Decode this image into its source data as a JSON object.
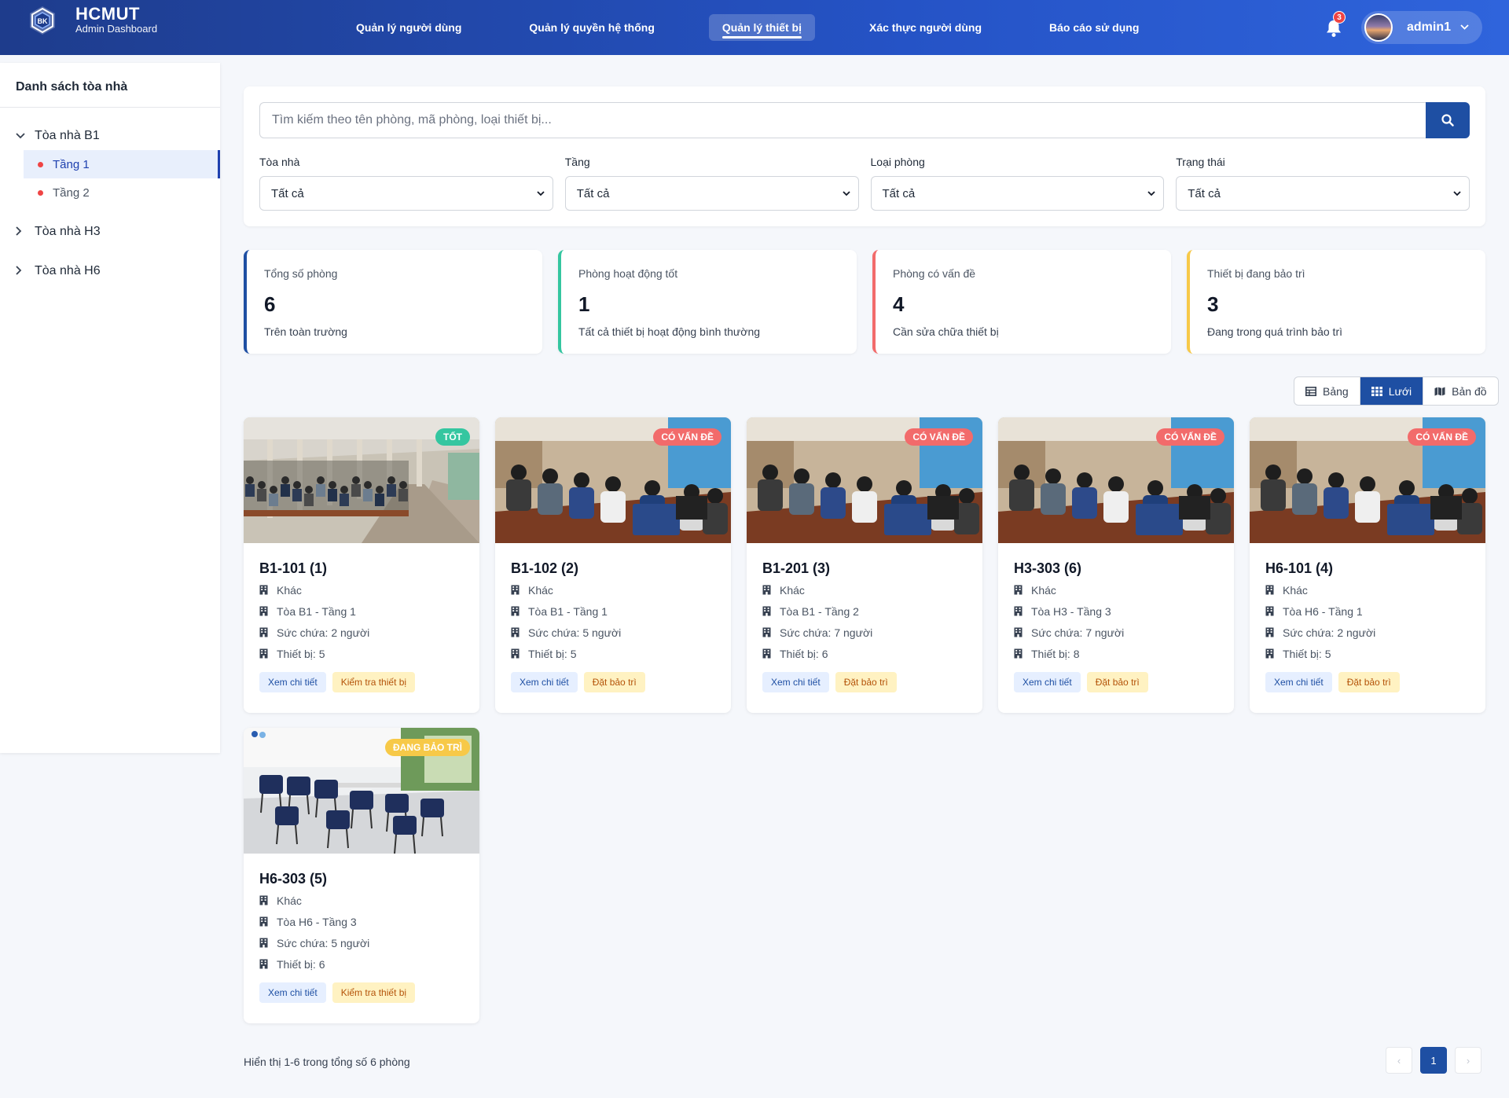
{
  "brand": {
    "title": "HCMUT",
    "subtitle": "Admin Dashboard",
    "logo_text": "BK"
  },
  "nav": [
    {
      "label": "Quản lý người dùng",
      "active": false
    },
    {
      "label": "Quản lý quyền hệ thống",
      "active": false
    },
    {
      "label": "Quản lý thiết bị",
      "active": true
    },
    {
      "label": "Xác thực người dùng",
      "active": false
    },
    {
      "label": "Báo cáo sử dụng",
      "active": false
    }
  ],
  "notifications": {
    "count": "3"
  },
  "user": {
    "name": "admin1"
  },
  "sidebar": {
    "title": "Danh sách tòa nhà",
    "buildings": [
      {
        "label": "Tòa nhà B1",
        "expanded": true,
        "floors": [
          {
            "label": "Tầng 1",
            "active": true
          },
          {
            "label": "Tầng 2",
            "active": false
          }
        ]
      },
      {
        "label": "Tòa nhà H3",
        "expanded": false,
        "floors": []
      },
      {
        "label": "Tòa nhà H6",
        "expanded": false,
        "floors": []
      }
    ]
  },
  "search": {
    "placeholder": "Tìm kiếm theo tên phòng, mã phòng, loại thiết bị..."
  },
  "filters": [
    {
      "label": "Tòa nhà",
      "value": "Tất cả"
    },
    {
      "label": "Tầng",
      "value": "Tất cả"
    },
    {
      "label": "Loại phòng",
      "value": "Tất cả"
    },
    {
      "label": "Trạng thái",
      "value": "Tất cả"
    }
  ],
  "stats": [
    {
      "label": "Tổng số phòng",
      "value": "6",
      "desc": "Trên toàn trường",
      "color": "#1e4fa3"
    },
    {
      "label": "Phòng hoạt động tốt",
      "value": "1",
      "desc": "Tất cả thiết bị hoạt động bình thường",
      "color": "#34c6a0"
    },
    {
      "label": "Phòng có vấn đề",
      "value": "4",
      "desc": "Cần sửa chữa thiết bị",
      "color": "#f26b6b"
    },
    {
      "label": "Thiết bị đang bảo trì",
      "value": "3",
      "desc": "Đang trong quá trình bảo trì",
      "color": "#f7c948"
    }
  ],
  "view_modes": [
    {
      "label": "Bảng",
      "active": false,
      "icon": "table-icon"
    },
    {
      "label": "Lưới",
      "active": true,
      "icon": "grid-icon"
    },
    {
      "label": "Bản đồ",
      "active": false,
      "icon": "map-icon"
    }
  ],
  "rooms": [
    {
      "title": "B1-101 (1)",
      "status": "TỐT",
      "status_color": "#34c6a0",
      "image": "corridor",
      "type": "Khác",
      "location": "Tòa B1 - Tầng 1",
      "capacity": "Sức chứa: 2 người",
      "devices": "Thiết bị: 5",
      "detail_label": "Xem chi tiết",
      "action_label": "Kiểm tra thiết bị"
    },
    {
      "title": "B1-102 (2)",
      "status": "CÓ VẤN ĐỀ",
      "status_color": "#f26b6b",
      "image": "lab",
      "type": "Khác",
      "location": "Tòa B1 - Tầng 1",
      "capacity": "Sức chứa: 5 người",
      "devices": "Thiết bị: 5",
      "detail_label": "Xem chi tiết",
      "action_label": "Đặt bảo trì"
    },
    {
      "title": "B1-201 (3)",
      "status": "CÓ VẤN ĐỀ",
      "status_color": "#f26b6b",
      "image": "lab",
      "type": "Khác",
      "location": "Tòa B1 - Tầng 2",
      "capacity": "Sức chứa: 7 người",
      "devices": "Thiết bị: 6",
      "detail_label": "Xem chi tiết",
      "action_label": "Đặt bảo trì"
    },
    {
      "title": "H3-303 (6)",
      "status": "CÓ VẤN ĐỀ",
      "status_color": "#f26b6b",
      "image": "lab",
      "type": "Khác",
      "location": "Tòa H3 - Tầng 3",
      "capacity": "Sức chứa: 7 người",
      "devices": "Thiết bị: 8",
      "detail_label": "Xem chi tiết",
      "action_label": "Đặt bảo trì"
    },
    {
      "title": "H6-101 (4)",
      "status": "CÓ VẤN ĐỀ",
      "status_color": "#f26b6b",
      "image": "lab",
      "type": "Khác",
      "location": "Tòa H6 - Tầng 1",
      "capacity": "Sức chứa: 2 người",
      "devices": "Thiết bị: 5",
      "detail_label": "Xem chi tiết",
      "action_label": "Đặt bảo trì"
    },
    {
      "title": "H6-303 (5)",
      "status": "ĐANG BẢO TRÌ",
      "status_color": "#f7c948",
      "image": "chairs",
      "type": "Khác",
      "location": "Tòa H6 - Tầng 3",
      "capacity": "Sức chứa: 5 người",
      "devices": "Thiết bị: 6",
      "detail_label": "Xem chi tiết",
      "action_label": "Kiểm tra thiết bị"
    }
  ],
  "pagination": {
    "summary": "Hiển thị 1-6 trong tổng số 6 phòng",
    "prev": "‹",
    "current": "1",
    "next": "›"
  }
}
